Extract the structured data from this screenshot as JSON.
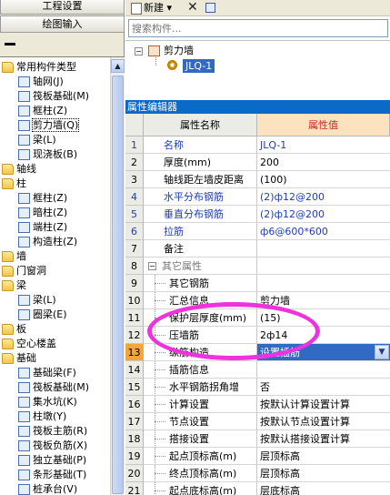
{
  "left": {
    "buttons": [
      "工程设置",
      "绘图输入"
    ],
    "tree": [
      {
        "label": "常用构件类型",
        "level": 0,
        "type": "folder"
      },
      {
        "label": "轴网(J)",
        "level": 1,
        "type": "elem"
      },
      {
        "label": "筏板基础(M)",
        "level": 1,
        "type": "elem"
      },
      {
        "label": "框柱(Z)",
        "level": 1,
        "type": "elem"
      },
      {
        "label": "剪力墙(Q)",
        "level": 1,
        "type": "elem",
        "selected": true
      },
      {
        "label": "梁(L)",
        "level": 1,
        "type": "elem"
      },
      {
        "label": "现浇板(B)",
        "level": 1,
        "type": "elem"
      },
      {
        "label": "轴线",
        "level": 0,
        "type": "folder"
      },
      {
        "label": "柱",
        "level": 0,
        "type": "folder"
      },
      {
        "label": "框柱(Z)",
        "level": 1,
        "type": "elem"
      },
      {
        "label": "暗柱(Z)",
        "level": 1,
        "type": "elem"
      },
      {
        "label": "端柱(Z)",
        "level": 1,
        "type": "elem"
      },
      {
        "label": "构造柱(Z)",
        "level": 1,
        "type": "elem"
      },
      {
        "label": "墙",
        "level": 0,
        "type": "folder"
      },
      {
        "label": "门窗洞",
        "level": 0,
        "type": "folder"
      },
      {
        "label": "梁",
        "level": 0,
        "type": "folder"
      },
      {
        "label": "梁(L)",
        "level": 1,
        "type": "elem"
      },
      {
        "label": "圈梁(E)",
        "level": 1,
        "type": "elem"
      },
      {
        "label": "板",
        "level": 0,
        "type": "folder"
      },
      {
        "label": "空心楼盖",
        "level": 0,
        "type": "folder"
      },
      {
        "label": "基础",
        "level": 0,
        "type": "folder"
      },
      {
        "label": "基础梁(F)",
        "level": 1,
        "type": "elem"
      },
      {
        "label": "筏板基础(M)",
        "level": 1,
        "type": "elem"
      },
      {
        "label": "集水坑(K)",
        "level": 1,
        "type": "elem"
      },
      {
        "label": "柱墩(Y)",
        "level": 1,
        "type": "elem"
      },
      {
        "label": "筏板主筋(R)",
        "level": 1,
        "type": "elem"
      },
      {
        "label": "筏板负筋(X)",
        "level": 1,
        "type": "elem"
      },
      {
        "label": "独立基础(P)",
        "level": 1,
        "type": "elem"
      },
      {
        "label": "条形基础(T)",
        "level": 1,
        "type": "elem"
      },
      {
        "label": "桩承台(V)",
        "level": 1,
        "type": "elem"
      }
    ]
  },
  "toolbar": {
    "new_label": "新建"
  },
  "search": {
    "placeholder": "搜索构件..."
  },
  "components": {
    "parent": "剪力墙",
    "child": "JLQ-1"
  },
  "props": {
    "title": "属性编辑器",
    "col_name": "属性名称",
    "col_value": "属性值",
    "rows": [
      {
        "idx": "1",
        "name": "名称",
        "value": "JLQ-1",
        "style": "blue"
      },
      {
        "idx": "2",
        "name": "厚度(mm)",
        "value": "200",
        "style": ""
      },
      {
        "idx": "3",
        "name": "轴线距左墙皮距离",
        "value": "(100)",
        "style": ""
      },
      {
        "idx": "4",
        "name": "水平分布钢筋",
        "value": "(2)ф12@200",
        "style": "blue"
      },
      {
        "idx": "5",
        "name": "垂直分布钢筋",
        "value": "(2)ф12@200",
        "style": "blue"
      },
      {
        "idx": "6",
        "name": "拉筋",
        "value": "ф6@600*600",
        "style": "blue"
      },
      {
        "idx": "7",
        "name": "备注",
        "value": "",
        "style": ""
      },
      {
        "idx": "8",
        "name": "其它属性",
        "value": "",
        "style": "grp"
      },
      {
        "idx": "9",
        "name": "其它钢筋",
        "value": "",
        "style": "sub"
      },
      {
        "idx": "10",
        "name": "汇总信息",
        "value": "剪力墙",
        "style": "sub"
      },
      {
        "idx": "11",
        "name": "保护层厚度(mm)",
        "value": "(15)",
        "style": "sub"
      },
      {
        "idx": "12",
        "name": "压墙筋",
        "value": "2ф14",
        "style": "sub"
      },
      {
        "idx": "13",
        "name": "纵筋构造",
        "value": "设置插筋",
        "style": "sub active"
      },
      {
        "idx": "14",
        "name": "插筋信息",
        "value": "",
        "style": "sub"
      },
      {
        "idx": "15",
        "name": "水平钢筋拐角增",
        "value": "否",
        "style": "sub"
      },
      {
        "idx": "16",
        "name": "计算设置",
        "value": "按默认计算设置计算",
        "style": "sub"
      },
      {
        "idx": "17",
        "name": "节点设置",
        "value": "按默认节点设置计算",
        "style": "sub"
      },
      {
        "idx": "18",
        "name": "搭接设置",
        "value": "按默认搭接设置计算",
        "style": "sub"
      },
      {
        "idx": "19",
        "name": "起点顶标高(m)",
        "value": "层顶标高",
        "style": "sub"
      },
      {
        "idx": "20",
        "name": "终点顶标高(m)",
        "value": "层顶标高",
        "style": "sub"
      },
      {
        "idx": "21",
        "name": "起点底标高(m)",
        "value": "层底标高",
        "style": "sub"
      }
    ]
  }
}
